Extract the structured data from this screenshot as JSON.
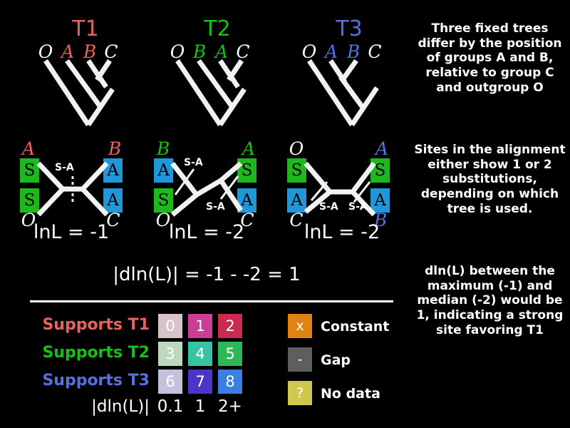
{
  "figure": {
    "background_color": "#000000",
    "stroke_color": "#f2f2f2"
  },
  "colors": {
    "t1": "#e8625e",
    "t2": "#14c214",
    "t3": "#5570e0",
    "white": "#ffffff",
    "state_s_bg": "#1eb81e",
    "state_a_bg": "#2196d8",
    "constant": "#e08214",
    "gap": "#5e5e5e",
    "nodata": "#cfc84e"
  },
  "trees": [
    {
      "title": "T1",
      "title_color": "#e8625e",
      "tips": [
        {
          "label": "O",
          "color": "#ffffff"
        },
        {
          "label": "A",
          "color": "#e8625e"
        },
        {
          "label": "B",
          "color": "#e8625e"
        },
        {
          "label": "C",
          "color": "#ffffff"
        }
      ]
    },
    {
      "title": "T2",
      "title_color": "#14c214",
      "tips": [
        {
          "label": "O",
          "color": "#ffffff"
        },
        {
          "label": "B",
          "color": "#14c214"
        },
        {
          "label": "A",
          "color": "#14c214"
        },
        {
          "label": "C",
          "color": "#ffffff"
        }
      ]
    },
    {
      "title": "T3",
      "title_color": "#5570e0",
      "tips": [
        {
          "label": "O",
          "color": "#ffffff"
        },
        {
          "label": "A",
          "color": "#5570e0"
        },
        {
          "label": "B",
          "color": "#5570e0"
        },
        {
          "label": "C",
          "color": "#ffffff"
        }
      ]
    }
  ],
  "quartets": [
    {
      "lnl": "lnL = -1",
      "corners": {
        "top_left": {
          "taxon": "A",
          "taxon_color": "#e8625e",
          "state": "S",
          "state_type": "S"
        },
        "bottom_left": {
          "taxon": "O",
          "taxon_color": "#ffffff",
          "state": "S",
          "state_type": "S"
        },
        "top_right": {
          "taxon": "B",
          "taxon_color": "#e8625e",
          "state": "A",
          "state_type": "A"
        },
        "bottom_right": {
          "taxon": "C",
          "taxon_color": "#ffffff",
          "state": "A",
          "state_type": "A"
        }
      },
      "substitutions": [
        {
          "label": "S-A"
        }
      ]
    },
    {
      "lnl": "lnL = -2",
      "corners": {
        "top_left": {
          "taxon": "B",
          "taxon_color": "#14c214",
          "state": "A",
          "state_type": "A"
        },
        "bottom_left": {
          "taxon": "O",
          "taxon_color": "#ffffff",
          "state": "S",
          "state_type": "S"
        },
        "top_right": {
          "taxon": "A",
          "taxon_color": "#14c214",
          "state": "S",
          "state_type": "S"
        },
        "bottom_right": {
          "taxon": "C",
          "taxon_color": "#ffffff",
          "state": "A",
          "state_type": "A"
        }
      },
      "substitutions": [
        {
          "label": "S-A"
        },
        {
          "label": "S-A"
        }
      ]
    },
    {
      "lnl": "lnL = -2",
      "corners": {
        "top_left": {
          "taxon": "O",
          "taxon_color": "#ffffff",
          "state": "S",
          "state_type": "S"
        },
        "bottom_left": {
          "taxon": "C",
          "taxon_color": "#ffffff",
          "state": "A",
          "state_type": "A"
        },
        "top_right": {
          "taxon": "A",
          "taxon_color": "#5570e0",
          "state": "S",
          "state_type": "S"
        },
        "bottom_right": {
          "taxon": "B",
          "taxon_color": "#5570e0",
          "state": "A",
          "state_type": "A"
        }
      },
      "substitutions": [
        {
          "label": "S-A"
        },
        {
          "label": "S-A"
        }
      ]
    }
  ],
  "equation": "|dln(L)| = -1 - -2 = 1",
  "side_notes": [
    "Three fixed trees differ by the position of groups A and B, relative to group C and outgroup O",
    "Sites in the alignment either show 1 or 2 substitutions, depending on which tree is used.",
    "dln(L) between the maximum (-1) and median (-2) would be 1, indicating a strong site favoring T1"
  ],
  "legend": {
    "support_rows": [
      {
        "label": "Supports T1",
        "label_color": "#e8625e",
        "swatches": [
          {
            "value": "0",
            "color": "#d8c3ca"
          },
          {
            "value": "1",
            "color": "#cc3d96"
          },
          {
            "value": "2",
            "color": "#cc2a4e"
          }
        ]
      },
      {
        "label": "Supports T2",
        "label_color": "#14c214",
        "swatches": [
          {
            "value": "3",
            "color": "#bcd8bf"
          },
          {
            "value": "4",
            "color": "#35c3a4"
          },
          {
            "value": "5",
            "color": "#2eb757"
          }
        ]
      },
      {
        "label": "Supports T3",
        "label_color": "#5570e0",
        "swatches": [
          {
            "value": "6",
            "color": "#c2c2dd"
          },
          {
            "value": "7",
            "color": "#4b35c7"
          },
          {
            "value": "8",
            "color": "#3b7fe0"
          }
        ]
      }
    ],
    "scale_label": "|dln(L)|",
    "scale_values": [
      "0.1",
      "1",
      "2+"
    ],
    "categories": [
      {
        "glyph": "x",
        "label": "Constant",
        "color": "#e08214"
      },
      {
        "glyph": "-",
        "label": "Gap",
        "color": "#5e5e5e"
      },
      {
        "glyph": "?",
        "label": "No data",
        "color": "#cfc84e"
      }
    ]
  }
}
